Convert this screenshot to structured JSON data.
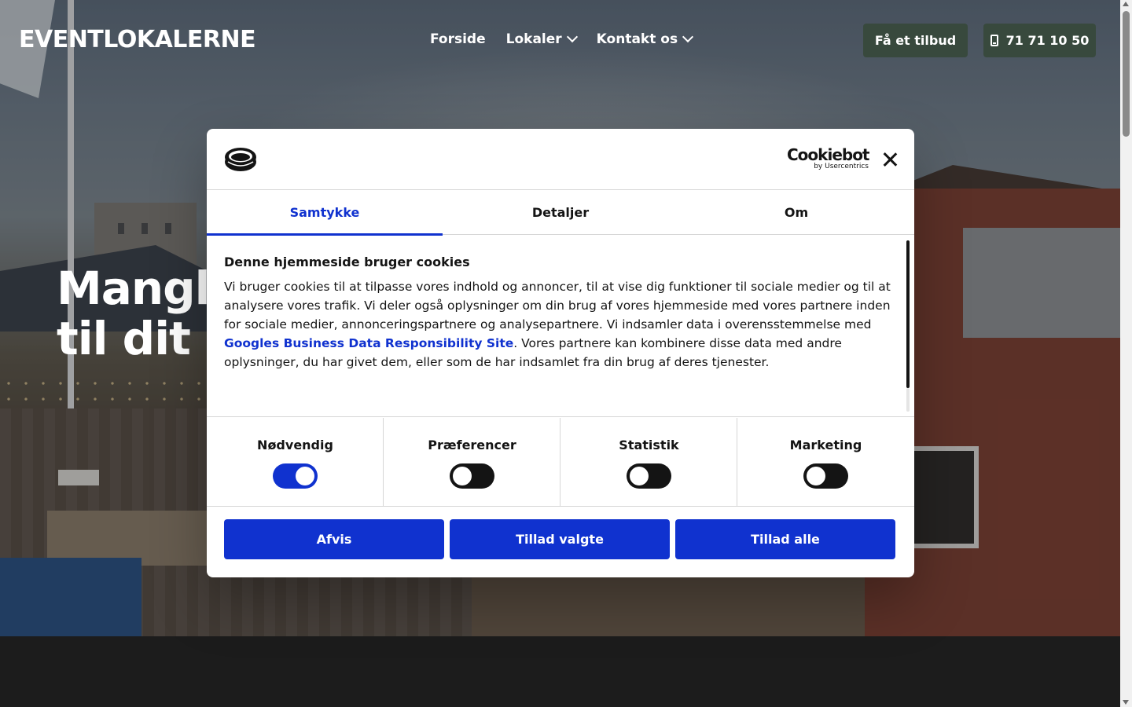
{
  "header": {
    "logo": "EVENTLOKALERNE",
    "nav": [
      {
        "label": "Forside",
        "has_dropdown": false
      },
      {
        "label": "Lokaler",
        "has_dropdown": true
      },
      {
        "label": "Kontakt os",
        "has_dropdown": true
      }
    ],
    "quote_button": "Få et tilbud",
    "phone_button": "71 71 10 50"
  },
  "hero": {
    "title": "Mangl\ntil dit a"
  },
  "cookie_dialog": {
    "brand_main": "Cookiebot",
    "brand_sub": "by Usercentrics",
    "tabs": [
      {
        "label": "Samtykke",
        "active": true
      },
      {
        "label": "Detaljer",
        "active": false
      },
      {
        "label": "Om",
        "active": false
      }
    ],
    "title": "Denne hjemmeside bruger cookies",
    "text_before_link": "Vi bruger cookies til at tilpasse vores indhold og annoncer, til at vise dig funktioner til sociale medier og til at analysere vores trafik. Vi deler også oplysninger om din brug af vores hjemmeside med vores partnere inden for sociale medier, annonceringspartnere og analysepartnere. Vi indsamler data i overensstemmelse med ",
    "link_text": "Googles Business Data Responsibility Site",
    "text_after_link": ". Vores partnere kan kombinere disse data med andre oplysninger, du har givet dem, eller som de har indsamlet fra din brug af deres tjenester.",
    "toggles": [
      {
        "label": "Nødvendig",
        "on": true
      },
      {
        "label": "Præferencer",
        "on": false
      },
      {
        "label": "Statistik",
        "on": false
      },
      {
        "label": "Marketing",
        "on": false
      }
    ],
    "buttons": {
      "reject": "Afvis",
      "allow_selected": "Tillad valgte",
      "allow_all": "Tillad alle"
    }
  },
  "colors": {
    "accent": "#1032cf",
    "header_button": "#38493d",
    "footer_band": "#1c1c1c"
  }
}
